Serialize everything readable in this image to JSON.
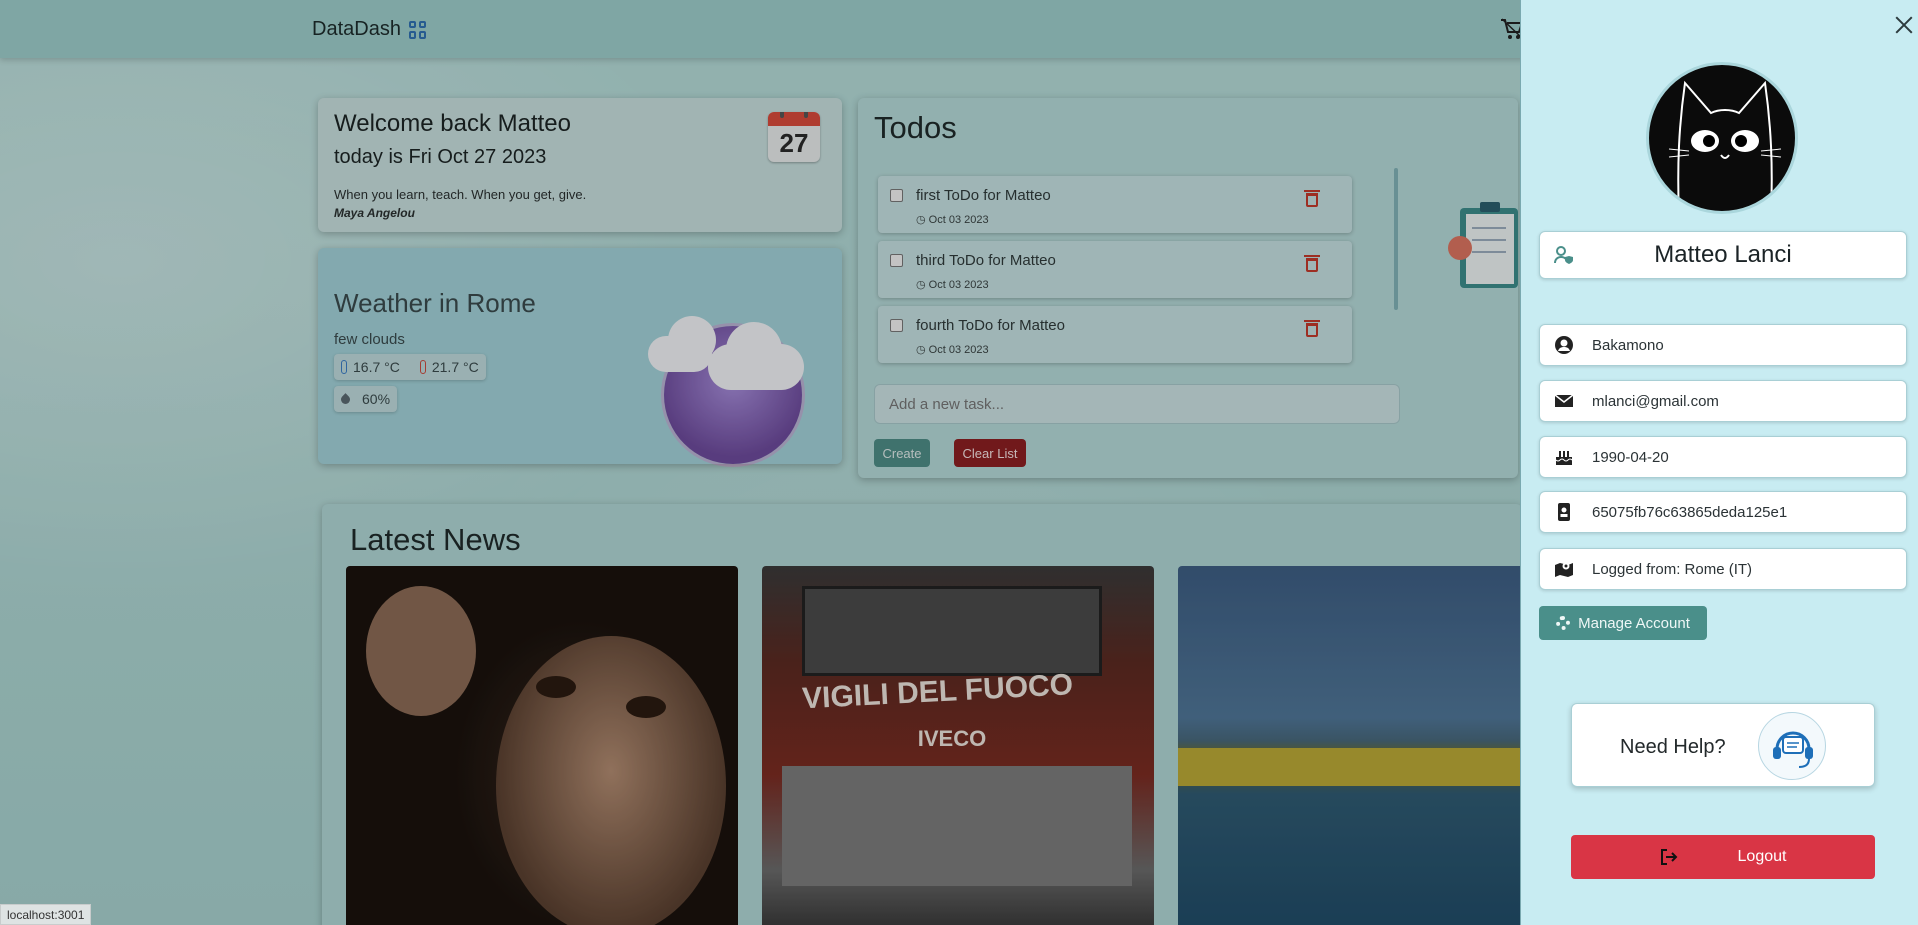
{
  "app": {
    "brand": "DataDash"
  },
  "welcome": {
    "greeting": "Welcome back Matteo",
    "date_line": "today is Fri Oct 27 2023",
    "calendar_day": "27",
    "quote": "When you learn, teach. When you get, give.",
    "author": "Maya Angelou"
  },
  "weather": {
    "title": "Weather in Rome",
    "description": "few clouds",
    "temp_min": "16.7 °C",
    "temp_max": "21.7 °C",
    "humidity": "60%"
  },
  "todos": {
    "title": "Todos",
    "items": [
      {
        "text": "first ToDo for Matteo",
        "date": "Oct 03 2023"
      },
      {
        "text": "third ToDo for Matteo",
        "date": "Oct 03 2023"
      },
      {
        "text": "fourth ToDo for Matteo",
        "date": "Oct 03 2023"
      }
    ],
    "input_placeholder": "Add a new task...",
    "create_label": "Create",
    "clear_label": "Clear List"
  },
  "news": {
    "title": "Latest News",
    "images": [
      {
        "icon": "chimpanzee-photo"
      },
      {
        "icon": "fire-truck-photo",
        "caption": "VIGILI DEL FUOCO",
        "brand": "IVECO"
      },
      {
        "icon": "venice-barriers-photo"
      }
    ]
  },
  "status_bar": {
    "url": "localhost:3001"
  },
  "profile": {
    "name": "Matteo Lanci",
    "username": "Bakamono",
    "email": "mlanci@gmail.com",
    "birthdate": "1990-04-20",
    "user_id": "65075fb76c63865deda125e1",
    "logged_from": "Logged from:  Rome (IT)",
    "manage_label": "Manage Account",
    "help_label": "Need Help?",
    "logout_label": "Logout"
  },
  "colors": {
    "accent": "#4a8f8a",
    "danger": "#d93545",
    "panel_bg": "#c8ecf2"
  }
}
